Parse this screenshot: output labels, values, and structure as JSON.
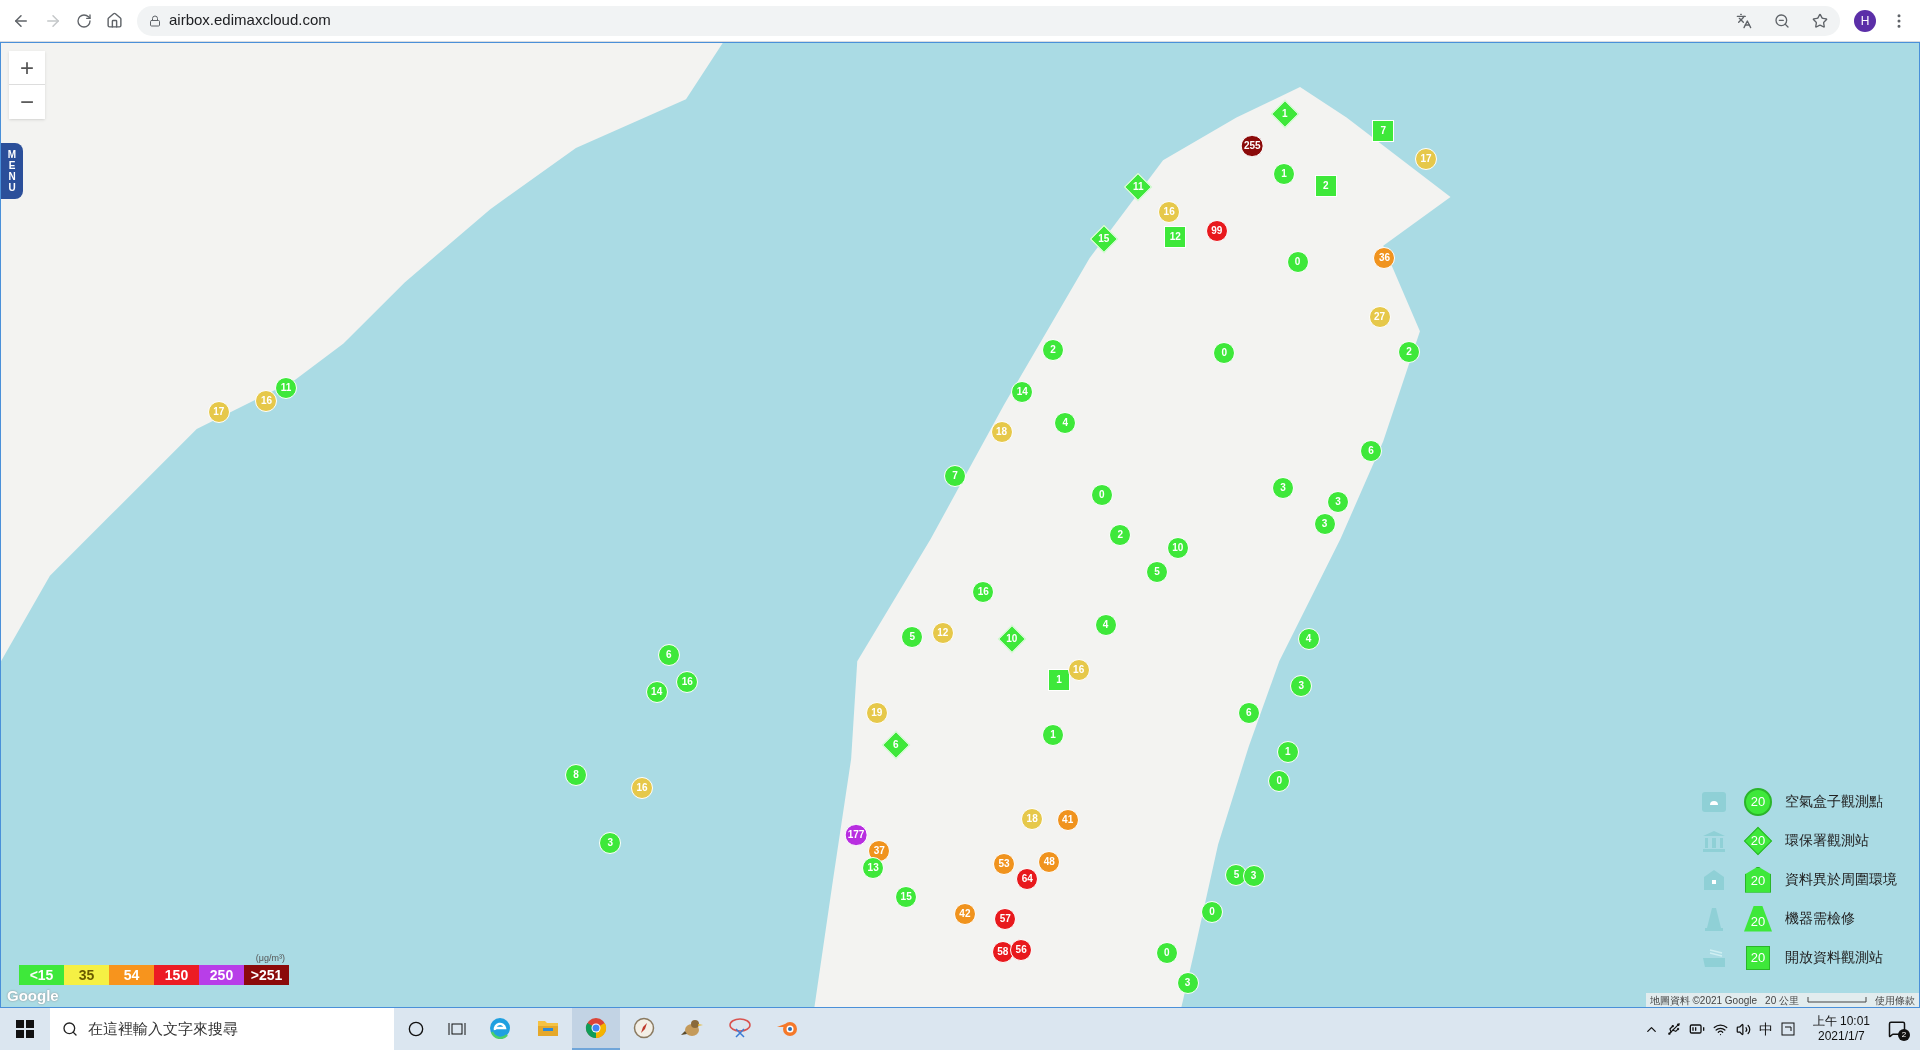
{
  "browser": {
    "url": "airbox.edimaxcloud.com",
    "profile_initial": "H"
  },
  "map": {
    "zoom_in": "+",
    "zoom_out": "−",
    "menu": "MENU",
    "markers": [
      {
        "kind": "circle",
        "value": "255",
        "color": "#8b0a0a"
      },
      {
        "kind": "circle",
        "value": "99",
        "color": "#e8191d"
      },
      {
        "kind": "circle",
        "value": "36",
        "color": "#f0931e"
      },
      {
        "kind": "circle",
        "value": "17",
        "color": "#e6c84a"
      },
      {
        "kind": "diamond",
        "value": "1",
        "color": "#3ee83a"
      },
      {
        "kind": "square",
        "value": "7",
        "color": "#3ee83a"
      },
      {
        "kind": "square",
        "value": "2",
        "color": "#3ee83a"
      },
      {
        "kind": "circle",
        "value": "1",
        "color": "#3ee83a"
      },
      {
        "kind": "diamond",
        "value": "15",
        "color": "#3ee83a"
      },
      {
        "kind": "circle",
        "value": "16",
        "color": "#e6c84a"
      },
      {
        "kind": "diamond",
        "value": "11",
        "color": "#3ee83a"
      },
      {
        "kind": "square",
        "value": "12",
        "color": "#3ee83a"
      },
      {
        "kind": "circle",
        "value": "0",
        "color": "#3ee83a"
      },
      {
        "kind": "circle",
        "value": "0",
        "color": "#3ee83a"
      },
      {
        "kind": "circle",
        "value": "2",
        "color": "#3ee83a"
      },
      {
        "kind": "circle",
        "value": "27",
        "color": "#e6c84a"
      },
      {
        "kind": "circle",
        "value": "6",
        "color": "#3ee83a"
      },
      {
        "kind": "circle",
        "value": "3",
        "color": "#3ee83a"
      },
      {
        "kind": "circle",
        "value": "3",
        "color": "#3ee83a"
      },
      {
        "kind": "circle",
        "value": "10",
        "color": "#3ee83a"
      },
      {
        "kind": "circle",
        "value": "2",
        "color": "#3ee83a"
      },
      {
        "kind": "circle",
        "value": "5",
        "color": "#3ee83a"
      },
      {
        "kind": "circle",
        "value": "0",
        "color": "#3ee83a"
      },
      {
        "kind": "circle",
        "value": "4",
        "color": "#3ee83a"
      },
      {
        "kind": "circle",
        "value": "14",
        "color": "#3ee83a"
      },
      {
        "kind": "circle",
        "value": "18",
        "color": "#e6c84a"
      },
      {
        "kind": "circle",
        "value": "2",
        "color": "#3ee83a"
      },
      {
        "kind": "circle",
        "value": "7",
        "color": "#3ee83a"
      },
      {
        "kind": "circle",
        "value": "16",
        "color": "#3ee83a"
      },
      {
        "kind": "diamond",
        "value": "10",
        "color": "#3ee83a"
      },
      {
        "kind": "square",
        "value": "1",
        "color": "#3ee83a"
      },
      {
        "kind": "circle",
        "value": "16",
        "color": "#e6c84a"
      },
      {
        "kind": "circle",
        "value": "4",
        "color": "#3ee83a"
      },
      {
        "kind": "circle",
        "value": "1",
        "color": "#3ee83a"
      },
      {
        "kind": "circle",
        "value": "5",
        "color": "#3ee83a"
      },
      {
        "kind": "circle",
        "value": "12",
        "color": "#e6c84a"
      },
      {
        "kind": "circle",
        "value": "19",
        "color": "#e6c84a"
      },
      {
        "kind": "diamond",
        "value": "6",
        "color": "#3ee83a"
      },
      {
        "kind": "circle",
        "value": "177",
        "color": "#b82ee0"
      },
      {
        "kind": "circle",
        "value": "37",
        "color": "#f0931e"
      },
      {
        "kind": "circle",
        "value": "42",
        "color": "#f0931e"
      },
      {
        "kind": "circle",
        "value": "64",
        "color": "#e8191d"
      },
      {
        "kind": "circle",
        "value": "57",
        "color": "#e8191d"
      },
      {
        "kind": "circle",
        "value": "58",
        "color": "#e8191d"
      },
      {
        "kind": "circle",
        "value": "56",
        "color": "#e8191d"
      },
      {
        "kind": "circle",
        "value": "41",
        "color": "#f0931e"
      },
      {
        "kind": "circle",
        "value": "48",
        "color": "#f0931e"
      },
      {
        "kind": "circle",
        "value": "53",
        "color": "#f0931e"
      },
      {
        "kind": "circle",
        "value": "18",
        "color": "#e6c84a"
      },
      {
        "kind": "circle",
        "value": "13",
        "color": "#3ee83a"
      },
      {
        "kind": "circle",
        "value": "15",
        "color": "#3ee83a"
      },
      {
        "kind": "circle",
        "value": "16",
        "color": "#e6c84a"
      },
      {
        "kind": "circle",
        "value": "6",
        "color": "#3ee83a"
      },
      {
        "kind": "circle",
        "value": "8",
        "color": "#3ee83a"
      },
      {
        "kind": "circle",
        "value": "3",
        "color": "#3ee83a"
      },
      {
        "kind": "circle",
        "value": "14",
        "color": "#3ee83a"
      },
      {
        "kind": "circle",
        "value": "16",
        "color": "#3ee83a"
      },
      {
        "kind": "circle",
        "value": "11",
        "color": "#3ee83a"
      },
      {
        "kind": "circle",
        "value": "16",
        "color": "#e6c84a"
      },
      {
        "kind": "circle",
        "value": "17",
        "color": "#e6c84a"
      },
      {
        "kind": "circle",
        "value": "0",
        "color": "#3ee83a"
      },
      {
        "kind": "circle",
        "value": "1",
        "color": "#3ee83a"
      },
      {
        "kind": "circle",
        "value": "6",
        "color": "#3ee83a"
      },
      {
        "kind": "circle",
        "value": "3",
        "color": "#3ee83a"
      },
      {
        "kind": "circle",
        "value": "4",
        "color": "#3ee83a"
      },
      {
        "kind": "circle",
        "value": "3",
        "color": "#3ee83a"
      },
      {
        "kind": "circle",
        "value": "5",
        "color": "#3ee83a"
      },
      {
        "kind": "circle",
        "value": "3",
        "color": "#3ee83a"
      },
      {
        "kind": "circle",
        "value": "0",
        "color": "#3ee83a"
      },
      {
        "kind": "circle",
        "value": "3",
        "color": "#3ee83a"
      },
      {
        "kind": "circle",
        "value": "0",
        "color": "#3ee83a"
      }
    ],
    "scale": {
      "unit": "(μg/m³)",
      "bands": [
        {
          "label": "<15",
          "color": "#3ee83a"
        },
        {
          "label": "35",
          "color": "#f5f044"
        },
        {
          "label": "54",
          "color": "#f7941d"
        },
        {
          "label": "150",
          "color": "#ec1c24"
        },
        {
          "label": "250",
          "color": "#b83ee8"
        },
        {
          "label": ">251",
          "color": "#8b0a0a"
        }
      ]
    },
    "legend": [
      {
        "kind": "circle",
        "value": "20",
        "label": "空氣盒子觀測點"
      },
      {
        "kind": "diamond",
        "value": "20",
        "label": "環保署觀測站"
      },
      {
        "kind": "house",
        "value": "20",
        "label": "資料異於周圍環境"
      },
      {
        "kind": "cone",
        "value": "20",
        "label": "機器需檢修"
      },
      {
        "kind": "square",
        "value": "20",
        "label": "開放資料觀測站"
      }
    ],
    "attribution": {
      "logo": "Google",
      "data": "地圖資料 ©2021 Google",
      "distance": "20 公里",
      "terms": "使用條款"
    }
  },
  "taskbar": {
    "search_placeholder": "在這裡輸入文字來搜尋",
    "apps": [
      {
        "kind": "edge",
        "selected": false
      },
      {
        "kind": "explorer",
        "selected": false
      },
      {
        "kind": "chrome",
        "selected": true
      },
      {
        "kind": "compass",
        "selected": false
      },
      {
        "kind": "bird",
        "selected": false
      },
      {
        "kind": "scissors",
        "selected": false
      },
      {
        "kind": "blender",
        "selected": false
      }
    ],
    "ime": "中",
    "time": "上午 10:01",
    "date": "2021/1/7",
    "notifications": "2"
  }
}
